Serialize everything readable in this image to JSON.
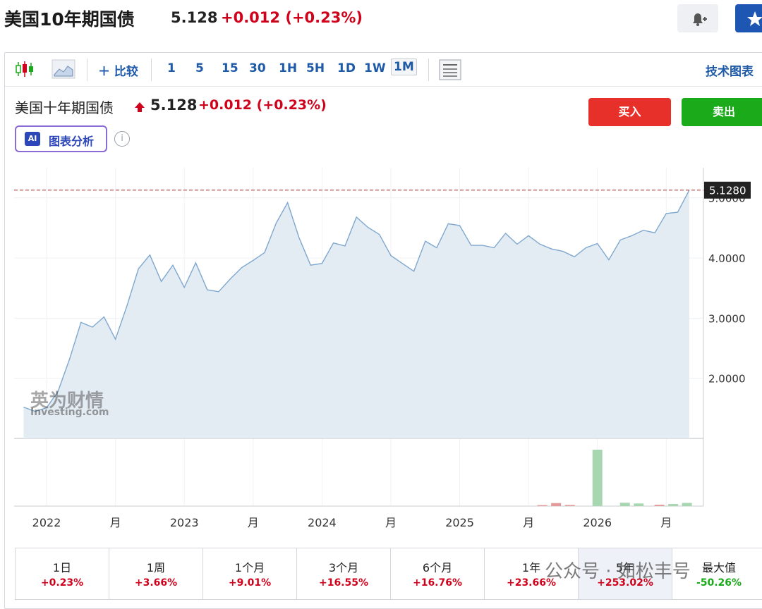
{
  "header": {
    "title": "美国10年期国债",
    "price": "5.128",
    "change": "+0.012",
    "change_pct": "(+0.23%)"
  },
  "toolbar": {
    "compare_label": "比较",
    "intervals": [
      "1",
      "5",
      "15",
      "30",
      "1H",
      "5H",
      "1D",
      "1W",
      "1M"
    ],
    "selected_interval": "1M",
    "tech_chart_label": "技术图表"
  },
  "quote": {
    "name": "美国十年期国债",
    "price": "5.128",
    "change": "+0.012",
    "change_pct": "(+0.23%)"
  },
  "actions": {
    "buy_label": "买入",
    "sell_label": "卖出"
  },
  "ai": {
    "badge": "AI",
    "label": "图表分析",
    "info": "i"
  },
  "logo": {
    "cn": "英为财情",
    "en": "Investing.com"
  },
  "watermark": "公众号 · 如松丰号",
  "colors": {
    "up": "#d0021b",
    "down": "#1aaa1a",
    "line": "#7fa7cf",
    "area": "#e4ecf3",
    "brand": "#1e5aa8"
  },
  "chart_data": {
    "type": "area",
    "ylim": [
      1.0,
      5.5
    ],
    "yticks": [
      "2.0000",
      "3.0000",
      "4.0000",
      "5.0000"
    ],
    "ytick_values": [
      2,
      3,
      4,
      5
    ],
    "last_value_label": "5.1280",
    "xticks": [
      "2022",
      "月",
      "2023",
      "月",
      "2024",
      "月",
      "2025",
      "月",
      "2026",
      "月"
    ],
    "xtick_values": [
      2022.0,
      2022.5,
      2023.0,
      2023.5,
      2024.0,
      2024.5,
      2025.0,
      2025.5,
      2026.0,
      2026.5
    ],
    "x": [
      2021.833,
      2021.917,
      2022.0,
      2022.083,
      2022.167,
      2022.25,
      2022.333,
      2022.417,
      2022.5,
      2022.583,
      2022.667,
      2022.75,
      2022.833,
      2022.917,
      2023.0,
      2023.083,
      2023.167,
      2023.25,
      2023.333,
      2023.417,
      2023.5,
      2023.583,
      2023.667,
      2023.75,
      2023.833,
      2023.917,
      2024.0,
      2024.083,
      2024.167,
      2024.25,
      2024.333,
      2024.417,
      2024.5,
      2024.583,
      2024.667,
      2024.75,
      2024.833,
      2024.917,
      2025.0,
      2025.083,
      2025.167,
      2025.25,
      2025.333,
      2025.417,
      2025.5,
      2025.583,
      2025.667,
      2025.75,
      2025.833,
      2025.917,
      2026.0,
      2026.083,
      2026.167,
      2026.25,
      2026.333,
      2026.417,
      2026.5,
      2026.583,
      2026.667
    ],
    "values": [
      1.52,
      1.45,
      1.51,
      1.78,
      2.32,
      2.93,
      2.85,
      3.02,
      2.65,
      3.2,
      3.82,
      4.05,
      3.61,
      3.88,
      3.51,
      3.92,
      3.47,
      3.44,
      3.65,
      3.84,
      3.96,
      4.09,
      4.58,
      4.92,
      4.34,
      3.88,
      3.91,
      4.25,
      4.2,
      4.68,
      4.51,
      4.39,
      4.04,
      3.91,
      3.78,
      4.28,
      4.17,
      4.57,
      4.54,
      4.21,
      4.21,
      4.17,
      4.41,
      4.23,
      4.37,
      4.23,
      4.15,
      4.11,
      4.02,
      4.17,
      4.24,
      3.97,
      4.3,
      4.37,
      4.46,
      4.42,
      4.74,
      4.76,
      5.128
    ],
    "volume": {
      "x": [
        2025.6,
        2025.7,
        2025.8,
        2026.0,
        2026.2,
        2026.3,
        2026.45,
        2026.55,
        2026.65
      ],
      "values": [
        0.5,
        1.6,
        0.6,
        30.0,
        1.8,
        1.4,
        0.7,
        1.1,
        1.7
      ],
      "up": [
        true,
        true,
        true,
        false,
        false,
        false,
        true,
        false,
        false
      ]
    }
  },
  "performance": [
    {
      "label": "1日",
      "value": "+0.23%"
    },
    {
      "label": "1周",
      "value": "+3.66%"
    },
    {
      "label": "1个月",
      "value": "+9.01%"
    },
    {
      "label": "3个月",
      "value": "+16.55%"
    },
    {
      "label": "6个月",
      "value": "+16.76%"
    },
    {
      "label": "1年",
      "value": "+23.66%"
    },
    {
      "label": "5年",
      "value": "+253.02%"
    },
    {
      "label": "最大值",
      "value": "-50.26%"
    }
  ]
}
